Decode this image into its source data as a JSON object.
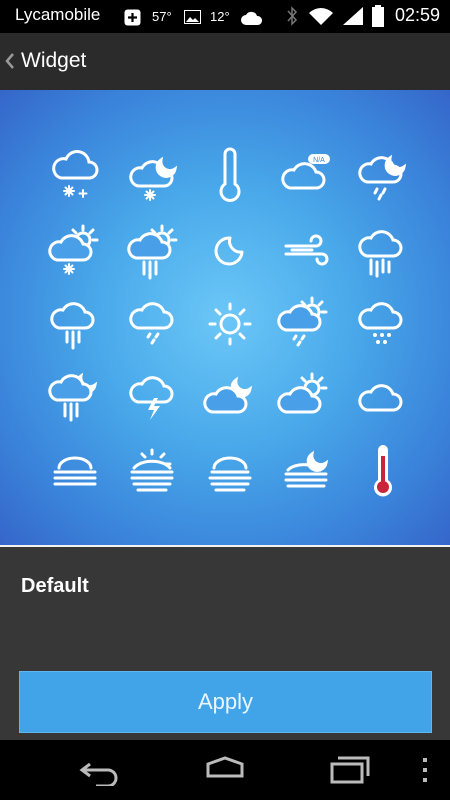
{
  "status_bar": {
    "carrier": "Lycamobile",
    "temp1": "57°",
    "temp2": "12°",
    "time": "02:59"
  },
  "action_bar": {
    "title": "Widget",
    "back_icon": "chevron-left-icon"
  },
  "preview": {
    "icons": [
      "snow-cloud-icon",
      "partly-cloudy-night-snow-icon",
      "thermometer-icon",
      "cloud-na-icon",
      "night-showers-icon",
      "sun-cloud-snow-icon",
      "sun-cloud-heavy-rain-icon",
      "moon-icon",
      "wind-icon",
      "windy-rain-icon",
      "rain-heavy-icon",
      "light-showers-icon",
      "sun-icon",
      "sun-cloud-showers-icon",
      "hail-icon",
      "night-heavy-rain-icon",
      "thunderstorm-icon",
      "partly-cloudy-night-icon",
      "partly-cloudy-day-icon",
      "cloud-icon",
      "fog-icon",
      "sun-haze-icon",
      "cloud-haze-icon",
      "night-haze-icon",
      "hot-thermometer-icon"
    ],
    "na_label": "N/A",
    "accent": "#3a84db"
  },
  "panel": {
    "theme_name": "Default",
    "apply_label": "Apply",
    "apply_color": "#42a4e8"
  },
  "nav_bar": {
    "buttons": [
      "back-icon",
      "home-icon",
      "recent-apps-icon",
      "menu-icon"
    ]
  }
}
